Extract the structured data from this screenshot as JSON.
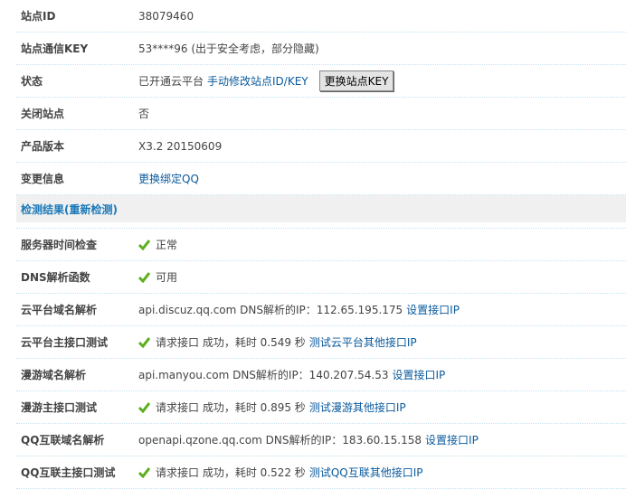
{
  "info_rows": [
    {
      "label": "站点ID",
      "value": "38079460"
    },
    {
      "label": "站点通信KEY",
      "value": "53****96 (出于安全考虑，部分隐藏)"
    },
    {
      "label": "状态",
      "value": "已开通云平台",
      "link": "手动修改站点ID/KEY",
      "button": "更换站点KEY"
    },
    {
      "label": "关闭站点",
      "value": "否"
    },
    {
      "label": "产品版本",
      "value": "X3.2 20150609"
    },
    {
      "label": "变更信息",
      "link": "更换绑定QQ"
    }
  ],
  "section_header": "检测结果(重新检测)",
  "check_rows": [
    {
      "label": "服务器时间检查",
      "ok": true,
      "value": "正常"
    },
    {
      "label": "DNS解析函数",
      "ok": true,
      "value": "可用"
    },
    {
      "label": "云平台域名解析",
      "ok": false,
      "value": "api.discuz.qq.com DNS解析的IP：112.65.195.175",
      "link": "设置接口IP"
    },
    {
      "label": "云平台主接口测试",
      "ok": true,
      "value": "请求接口 成功，耗时 0.549 秒",
      "link": "测试云平台其他接口IP"
    },
    {
      "label": "漫游域名解析",
      "ok": false,
      "value": "api.manyou.com DNS解析的IP：140.207.54.53",
      "link": "设置接口IP"
    },
    {
      "label": "漫游主接口测试",
      "ok": true,
      "value": "请求接口 成功，耗时 0.895 秒",
      "link": "测试漫游其他接口IP"
    },
    {
      "label": "QQ互联域名解析",
      "ok": false,
      "value": "openapi.qzone.qq.com DNS解析的IP：183.60.15.158",
      "link": "设置接口IP"
    },
    {
      "label": "QQ互联主接口测试",
      "ok": true,
      "value": "请求接口 成功，耗时 0.522 秒",
      "link": "测试QQ互联其他接口IP"
    }
  ]
}
